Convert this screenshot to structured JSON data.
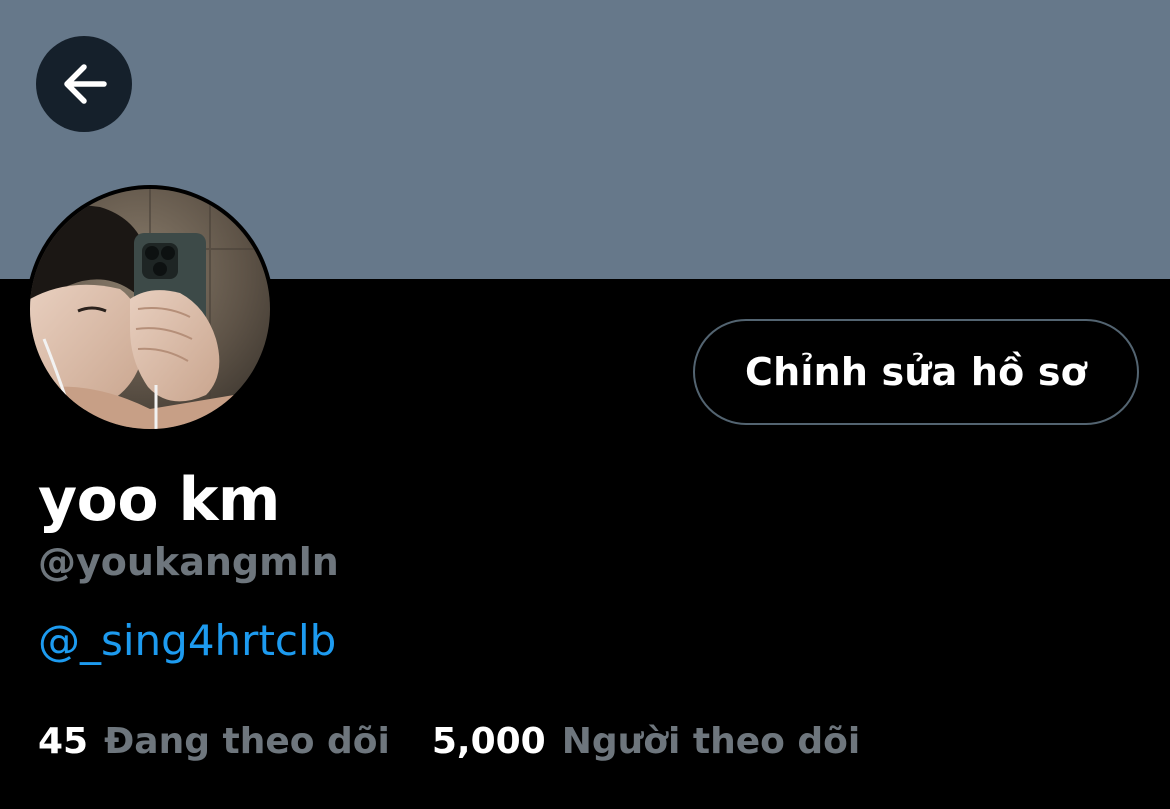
{
  "profile": {
    "display_name": "yoo km",
    "handle": "@youkangmln",
    "bio_mention": "@_sing4hrtclb"
  },
  "header": {
    "back_icon": "arrow-left-icon"
  },
  "actions": {
    "edit_profile_label": "Chỉnh sửa hồ sơ"
  },
  "stats": {
    "following": {
      "count": "45",
      "label": "Đang theo dõi"
    },
    "followers": {
      "count": "5,000",
      "label": "Người theo dõi"
    }
  },
  "colors": {
    "banner": "#66788a",
    "background": "#000000",
    "link": "#1d9bf0",
    "secondary_text": "#6e767d",
    "button_border": "#536471"
  }
}
